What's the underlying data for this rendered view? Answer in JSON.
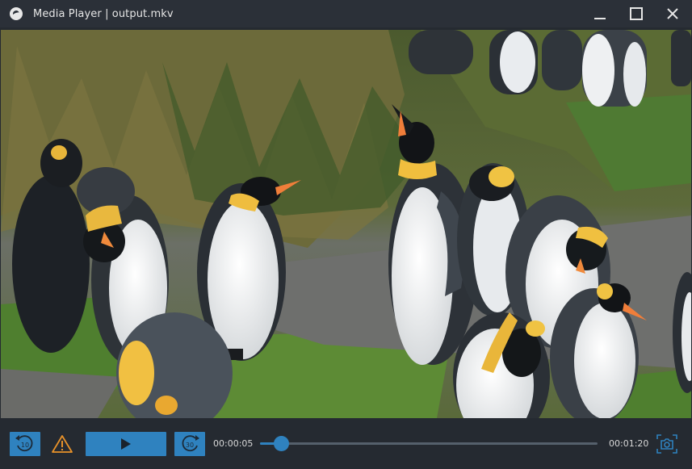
{
  "window": {
    "title": "Media Player | output.mkv"
  },
  "icons": {
    "app": "player-logo-icon",
    "minimize": "minimize-icon",
    "maximize": "maximize-icon",
    "close": "close-icon",
    "rewind": "rewind-10-icon",
    "forward": "forward-30-icon",
    "warning": "warning-icon",
    "play": "play-icon",
    "snapshot": "camera-icon"
  },
  "controls": {
    "rewind_label": "10",
    "forward_label": "30",
    "current_time": "00:00:05",
    "total_time": "00:01:20",
    "progress": 0.0625
  },
  "video": {
    "scene": "penguins"
  },
  "colors": {
    "accent": "#2f82bf",
    "warning": "#e8922a",
    "background": "#252a31",
    "titlebar": "#2b3038"
  }
}
